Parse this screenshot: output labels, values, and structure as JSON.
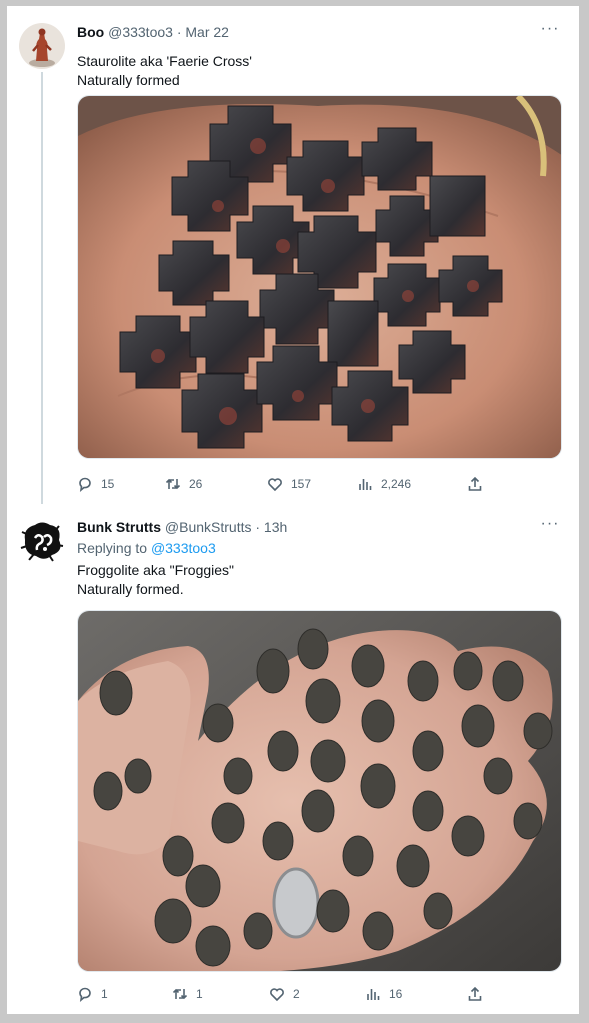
{
  "tweets": [
    {
      "display_name": "Boo",
      "handle": "@333too3",
      "separator": "·",
      "date": "Mar 22",
      "more_label": "···",
      "text": "Staurolite aka 'Faerie Cross'\nNaturally formed",
      "media_description": "staurolite-crystals-on-palm",
      "actions": {
        "replies": "15",
        "retweets": "26",
        "likes": "157",
        "views": "2,246"
      }
    },
    {
      "display_name": "Bunk Strutts",
      "handle": "@BunkStrutts",
      "separator": "·",
      "date": "13h",
      "more_label": "···",
      "replying_prefix": "Replying to",
      "replying_handle": "@333too3",
      "text": "Froggolite aka \"Froggies\"\nNaturally formed.",
      "media_description": "tiny-toads-on-hand",
      "actions": {
        "replies": "1",
        "retweets": "1",
        "likes": "2",
        "views": "16"
      }
    }
  ],
  "colors": {
    "text_primary": "#0f1419",
    "text_secondary": "#536471",
    "link": "#1d9bf0",
    "thread_line": "#cfd9de"
  },
  "icons": [
    "reply-icon",
    "retweet-icon",
    "like-icon",
    "views-icon",
    "share-icon",
    "more-icon"
  ]
}
